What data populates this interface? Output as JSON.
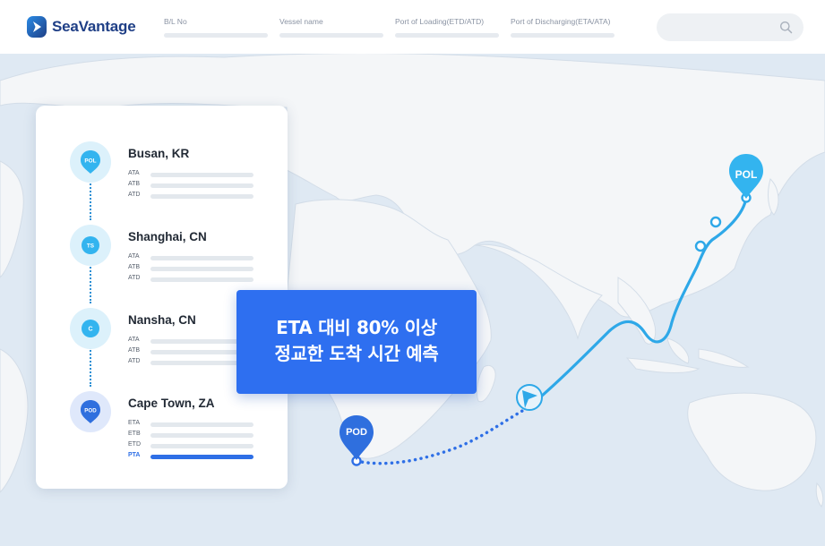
{
  "app": {
    "name": "SeaVantage"
  },
  "header": {
    "fields": [
      {
        "label": "B/L No"
      },
      {
        "label": "Vessel name"
      },
      {
        "label": "Port of Loading(ETD/ATD)"
      },
      {
        "label": "Port of Discharging(ETA/ATA)"
      }
    ],
    "search": {
      "icon": "search-icon"
    }
  },
  "route": {
    "stops": [
      {
        "name": "Busan, KR",
        "badge": "POL",
        "rows": [
          "ATA",
          "ATB",
          "ATD"
        ]
      },
      {
        "name": "Shanghai, CN",
        "badge": "TS",
        "rows": [
          "ATA",
          "ATB",
          "ATD"
        ]
      },
      {
        "name": "Nansha, CN",
        "badge": "C",
        "rows": [
          "ATA",
          "ATB",
          "ATD"
        ]
      },
      {
        "name": "Cape Town, ZA",
        "badge": "POD",
        "rows": [
          "ETA",
          "ETB",
          "ETD",
          "PTA"
        ]
      }
    ]
  },
  "banner": {
    "line1": "ETA 대비 80% 이상",
    "line2": "정교한 도착 시간 예측"
  },
  "map": {
    "pol_label": "POL",
    "pod_label": "POD",
    "colors": {
      "route": "#2ea8e8",
      "pod": "#2f6fde",
      "pol": "#33b4ef",
      "ocean": "#dfe9f3",
      "land": "#f4f6f8"
    }
  }
}
